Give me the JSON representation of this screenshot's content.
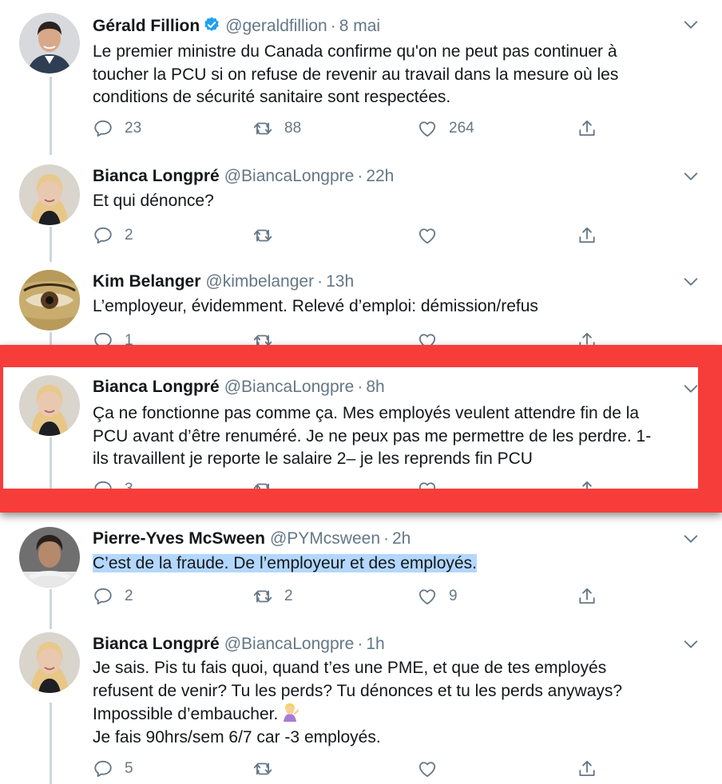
{
  "tweets": [
    {
      "name": "Gérald Fillion",
      "verified": true,
      "handle": "@geraldfillion",
      "time": "8 mai",
      "lines": [
        "Le premier ministre du Canada confirme qu'on ne peut pas continuer à",
        "toucher la PCU si on refuse de revenir au travail dans la mesure où les",
        "conditions de sécurité sanitaire sont respectées."
      ],
      "replies": "23",
      "retweets": "88",
      "likes": "264"
    },
    {
      "name": "Bianca Longpré",
      "handle": "@BiancaLongpre",
      "time": "22h",
      "lines": [
        "Et qui dénonce?"
      ],
      "replies": "2",
      "retweets": "",
      "likes": ""
    },
    {
      "name": "Kim Belanger",
      "handle": "@kimbelanger",
      "time": "13h",
      "lines": [
        "L’employeur, évidemment. Relevé d’emploi: démission/refus"
      ],
      "replies": "1",
      "retweets": "",
      "likes": ""
    },
    {
      "name": "Bianca Longpré",
      "handle": "@BiancaLongpre",
      "time": "8h",
      "lines": [
        "Ça ne fonctionne pas comme ça. Mes employés veulent attendre fin de la",
        "PCU avant d’être renuméré. Je ne peux pas me permettre de les perdre. 1-",
        "ils travaillent je reporte le salaire 2– je les reprends fin PCU"
      ],
      "replies": "3",
      "retweets": "",
      "likes": ""
    },
    {
      "name": "Pierre-Yves McSween",
      "handle": "@PYMcsween",
      "time": "2h",
      "lines": [
        "C’est de la fraude. De l’employeur et des employés."
      ],
      "replies": "2",
      "retweets": "2",
      "likes": "9"
    },
    {
      "name": "Bianca Longpré",
      "handle": "@BiancaLongpre",
      "time": "1h",
      "lines": [
        "Je sais. Pis tu fais quoi, quand t’es une PME, et que de tes employés",
        "refusent de venir? Tu les perds? Tu dénonces et tu les perds anyways?",
        "Impossible d’embaucher.",
        "Je fais 90hrs/sem 6/7 car -3 employés."
      ],
      "replies": "5",
      "retweets": "",
      "likes": ""
    }
  ],
  "icons": {
    "reply": "reply-icon",
    "retweet": "retweet-icon",
    "like": "heart-icon",
    "share": "share-icon",
    "caret": "chevron-down-icon",
    "verified": "verified-badge-icon",
    "emoji": "woman-tipping-hand-emoji"
  },
  "colors": {
    "accent": "#1da1f2",
    "muted": "#657786",
    "highlight_frame": "#f73d3a",
    "selection": "#b3d7ff"
  }
}
